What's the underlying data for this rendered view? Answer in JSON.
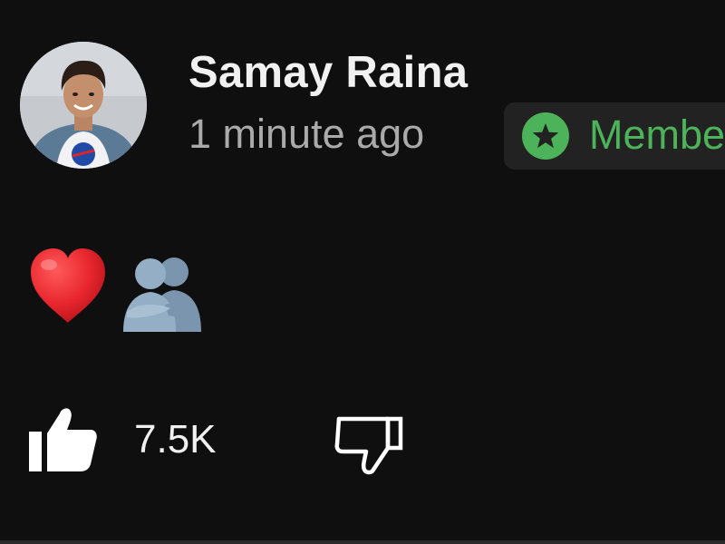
{
  "comment": {
    "author": {
      "name": "Samay Raina",
      "avatar": "profile-photo-icon"
    },
    "timestamp": "1 minute ago",
    "member_badge": {
      "label": "Member",
      "icon": "star-icon",
      "accent_color": "#4db35a"
    },
    "body": {
      "emojis": [
        {
          "glyph": "❤️",
          "icon": "red-heart-icon"
        },
        {
          "glyph": "🫂",
          "icon": "people-hugging-icon"
        }
      ]
    },
    "actions": {
      "like_icon": "thumbs-up-icon",
      "like_count": "7.5K",
      "dislike_icon": "thumbs-down-icon"
    }
  },
  "theme": {
    "background": "#0f0f0f",
    "text_primary": "#f1f1f1",
    "text_secondary": "#aaaaaa",
    "badge_background": "#222222"
  }
}
